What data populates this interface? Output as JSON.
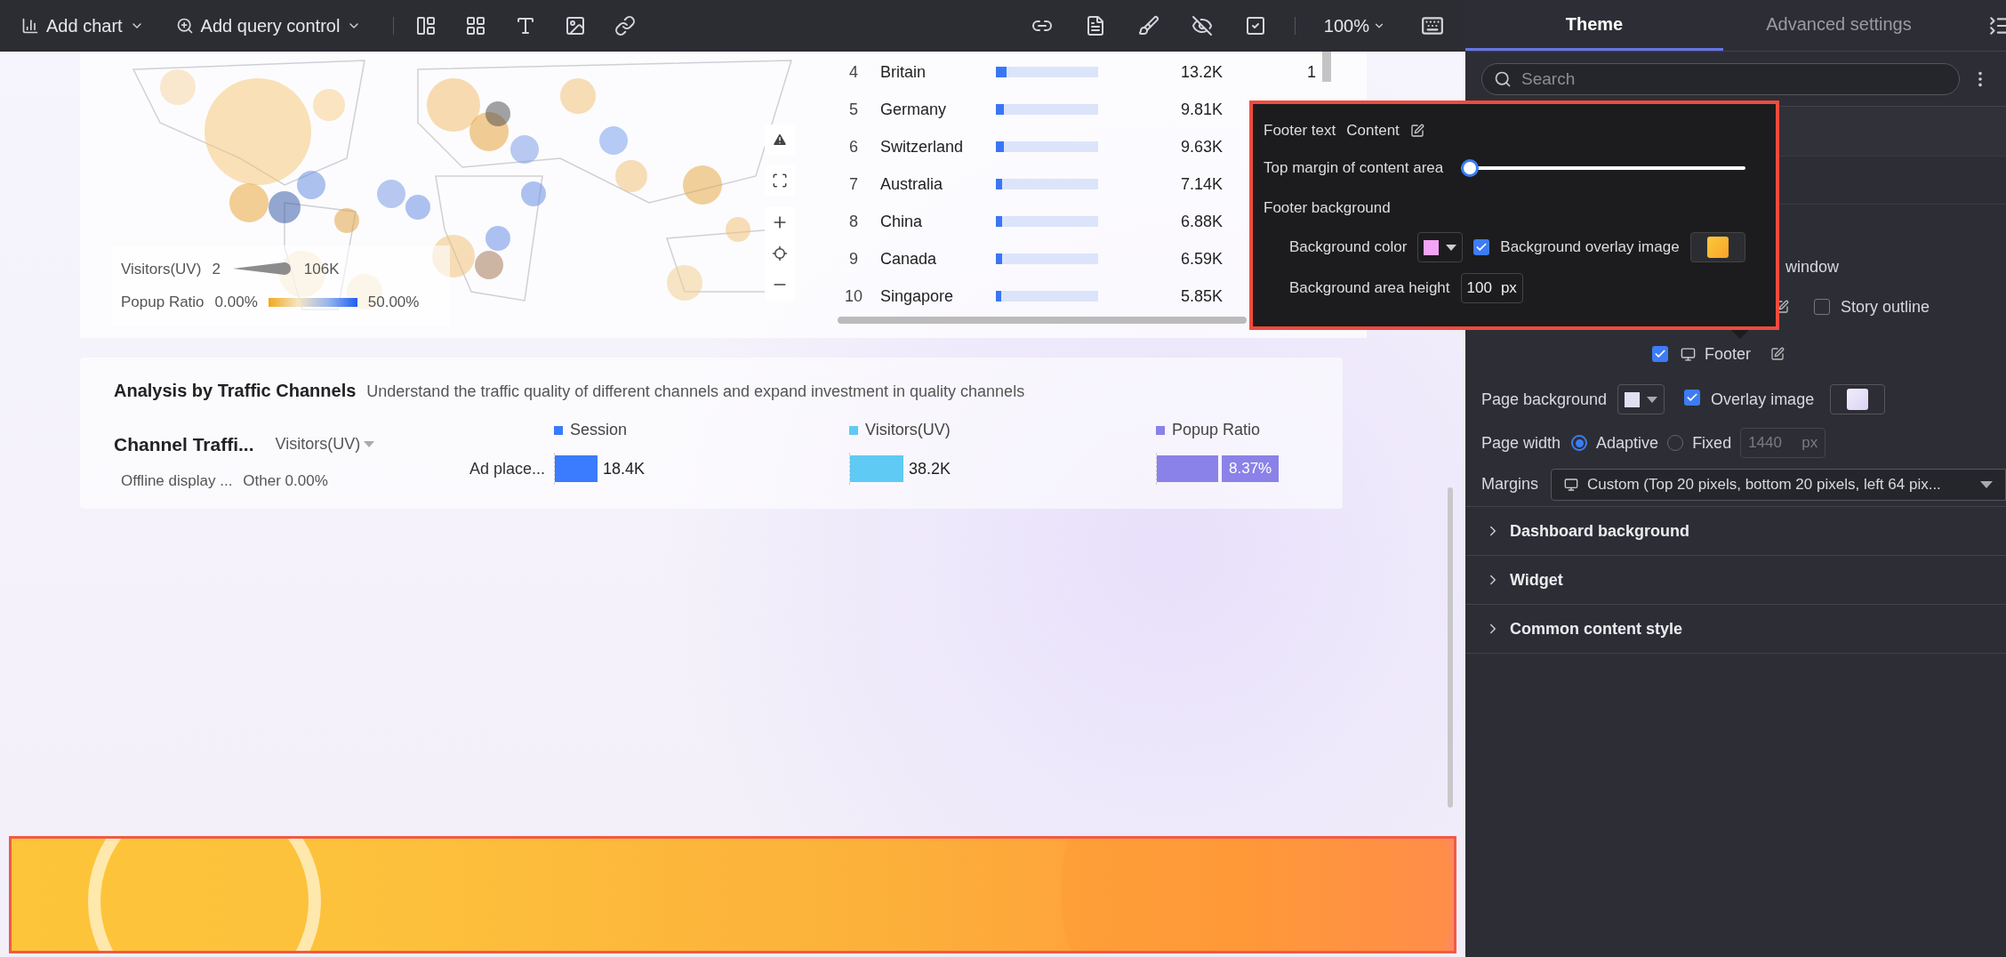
{
  "toolbar": {
    "menus": [
      {
        "kind": "chart",
        "label": "Add chart"
      },
      {
        "kind": "query",
        "label": "Add query control"
      }
    ],
    "zoom": "100%"
  },
  "map": {
    "legend": {
      "size_label": "Visitors(UV)",
      "size_min": "2",
      "size_max": "106K",
      "color_label": "Popup Ratio",
      "color_min": "0.00%",
      "color_max": "50.00%"
    }
  },
  "ranking_table": {
    "rows": [
      {
        "rank": "4",
        "name": "Britain",
        "level": 0.1,
        "value": "13.2K",
        "column_5": "1"
      },
      {
        "rank": "5",
        "name": "Germany",
        "level": 0.08,
        "value": "9.81K"
      },
      {
        "rank": "6",
        "name": "Switzerland",
        "level": 0.08,
        "value": "9.63K"
      },
      {
        "rank": "7",
        "name": "Australia",
        "level": 0.06,
        "value": "7.14K"
      },
      {
        "rank": "8",
        "name": "China",
        "level": 0.06,
        "value": "6.88K"
      },
      {
        "rank": "9",
        "name": "Canada",
        "level": 0.06,
        "value": "6.59K"
      },
      {
        "rank": "10",
        "name": "Singapore",
        "level": 0.05,
        "value": "5.85K"
      }
    ]
  },
  "analysis": {
    "title": "Analysis by Traffic Channels",
    "subtitle": "Understand the traffic quality of different channels and expand investment in quality channels",
    "chart_title": "Channel Traffi...",
    "metric_select": "Visitors(UV)",
    "legend": [
      {
        "name": "Session",
        "color": "#3b7bfd"
      },
      {
        "name": "Visitors(UV)",
        "color": "#5fcaf4"
      },
      {
        "name": "Popup Ratio",
        "color": "#8a82e8"
      }
    ],
    "rows": [
      {
        "label": "Ad place...",
        "bars": [
          {
            "value": "18.4K",
            "level": 0.16
          },
          {
            "value": "38.2K",
            "level": 0.2
          },
          {
            "value": "8.37%",
            "level": 0.23
          }
        ]
      }
    ],
    "pie_labels": [
      "Offline display ...",
      "Other 0.00%"
    ]
  },
  "footer_popup": {
    "text_label": "Footer text",
    "text_value": "Content",
    "margin": {
      "label": "Top margin of content area",
      "level": 0
    },
    "background_label": "Footer background",
    "color_label": "Background color",
    "color": "#f4a4f4",
    "overlay_checked": true,
    "overlay_label": "Background overlay image",
    "height_label": "Background area height",
    "height_value": "100",
    "height_unit": "px"
  },
  "panel": {
    "tabs": [
      {
        "label": "Theme",
        "selected": true
      },
      {
        "label": "Advanced settings",
        "selected": false
      }
    ],
    "search_placeholder": "Search",
    "window_text": "window",
    "story_outline": {
      "label": "Story outline",
      "checked": false
    },
    "footer": {
      "label": "Footer",
      "checked": true
    },
    "page_background": {
      "label": "Page background",
      "color": "#dfe1f3",
      "overlay_checked": true,
      "overlay_label": "Overlay image"
    },
    "page_width": {
      "label": "Page width",
      "options": [
        {
          "label": "Adaptive",
          "selected": true
        },
        {
          "label": "Fixed",
          "selected": false
        }
      ],
      "value": "1440",
      "unit": "px",
      "disabled": true
    },
    "margins": {
      "label": "Margins",
      "value": "Custom (Top 20 pixels, bottom 20 pixels, left 64 pix..."
    },
    "sections": [
      {
        "label": "Dashboard background",
        "expanded": false
      },
      {
        "label": "Widget",
        "expanded": false
      },
      {
        "label": "Common content style",
        "expanded": false
      }
    ]
  }
}
